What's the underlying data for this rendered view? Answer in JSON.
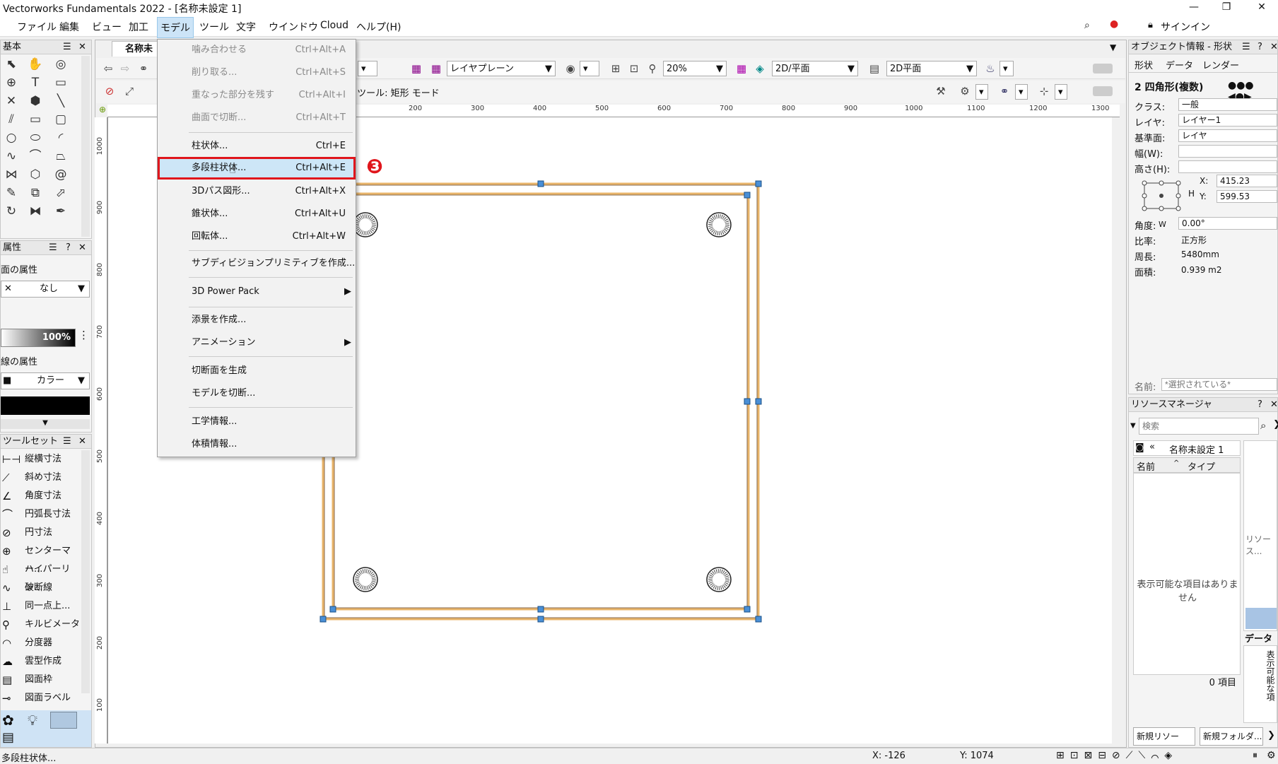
{
  "window": {
    "title": "Vectorworks Fundamentals 2022 - [名称未設定 1]"
  },
  "menubar": [
    "ファイル",
    "編集",
    "ビュー",
    "加工",
    "モデル",
    "ツール",
    "文字",
    "ウインドウ",
    "Cloud",
    "ヘルプ(H)"
  ],
  "signin": "サインイン",
  "model_menu": {
    "items": [
      {
        "label": "噛み合わせる",
        "shortcut": "Ctrl+Alt+A",
        "disabled": true
      },
      {
        "label": "削り取る...",
        "shortcut": "Ctrl+Alt+S",
        "disabled": true
      },
      {
        "label": "重なった部分を残す",
        "shortcut": "Ctrl+Alt+I",
        "disabled": true
      },
      {
        "label": "曲面で切断...",
        "shortcut": "Ctrl+Alt+T",
        "disabled": true
      },
      {
        "label": "柱状体...",
        "shortcut": "Ctrl+E"
      },
      {
        "label": "多段柱状体...",
        "shortcut": "Ctrl+Alt+E",
        "highlighted": true
      },
      {
        "label": "3Dパス図形...",
        "shortcut": "Ctrl+Alt+X"
      },
      {
        "label": "錐状体...",
        "shortcut": "Ctrl+Alt+U"
      },
      {
        "label": "回転体...",
        "shortcut": "Ctrl+Alt+W"
      },
      {
        "label": "サブディビジョンプリミティブを作成..."
      },
      {
        "label": "3D Power Pack",
        "submenu": true
      },
      {
        "label": "添景を作成..."
      },
      {
        "label": "アニメーション",
        "submenu": true
      },
      {
        "label": "切断面を生成"
      },
      {
        "label": "モデルを切断..."
      },
      {
        "label": "工学情報..."
      },
      {
        "label": "体積情報..."
      }
    ],
    "step_badge": "❸"
  },
  "view_bar": {
    "tab": "名称未",
    "layer_plane": "レイヤプレーン",
    "zoom": "20%",
    "view": "2D/平面",
    "render": "2D平面",
    "mode_text": "ン ツール: 矩形 モード"
  },
  "ruler_top": [
    "200",
    "300",
    "400",
    "500",
    "600",
    "700",
    "800",
    "900",
    "1000",
    "1100",
    "1200",
    "1300"
  ],
  "ruler_left": [
    "1000",
    "900",
    "800",
    "700",
    "600",
    "500",
    "400",
    "300",
    "200",
    "100"
  ],
  "left_panels": {
    "basic_title": "基本",
    "attr_title": "属性",
    "fill_attr": "面の属性",
    "fill_value": "なし",
    "opacity": "100%",
    "line_attr": "線の属性",
    "line_value": "カラー",
    "toolset_title": "ツールセット",
    "tools": [
      "縦横寸法",
      "斜め寸法",
      "角度寸法",
      "円弧長寸法",
      "円寸法",
      "センターマー...",
      "ハイパーリン...",
      "破断線",
      "同一点上...",
      "キルビメータ",
      "分度器",
      "雲型作成",
      "図面枠",
      "図面ラベル"
    ]
  },
  "obj_info": {
    "title": "オブジェクト情報 - 形状",
    "tabs": [
      "形状",
      "データ",
      "レンダー"
    ],
    "object": "2 四角形(複数)",
    "class_label": "クラス:",
    "class_value": "一般",
    "layer_label": "レイヤ:",
    "layer_value": "レイヤー1",
    "plane_label": "基準面:",
    "plane_value": "レイヤ",
    "width_label": "幅(W):",
    "height_label": "高さ(H):",
    "x_label": "X:",
    "x_value": "415.23",
    "y_label": "Y:",
    "y_value": "599.53",
    "h_label": "H",
    "w_label": "W",
    "angle_label": "角度:",
    "angle_value": "0.00°",
    "ratio_label": "比率:",
    "ratio_value": "正方形",
    "perim_label": "周長:",
    "perim_value": "5480mm",
    "area_label": "面積:",
    "area_value": "0.939 m2",
    "name_label": "名前:",
    "name_placeholder": "*選択されている*"
  },
  "resource_mgr": {
    "title": "リソースマネージャ",
    "search_placeholder": "検索",
    "file": "名称未設定 1",
    "col_name": "名前",
    "col_type": "タイプ",
    "empty": "表示可能な項目はありません",
    "count": "0 項目",
    "side_text": "リソース...",
    "data_label": "データ",
    "data_empty": "表示可能な項",
    "btn_new_res": "新規リソース...",
    "btn_new_folder": "新規フォルダ..."
  },
  "status": {
    "left": "多段柱状体...",
    "x": "X: -126",
    "y": "Y: 1074"
  },
  "colors": {
    "highlight_border": "#e0161c",
    "menu_highlight": "#cde6f7",
    "rect_stroke": "#e8b46a",
    "handle": "#4a8fd6"
  }
}
